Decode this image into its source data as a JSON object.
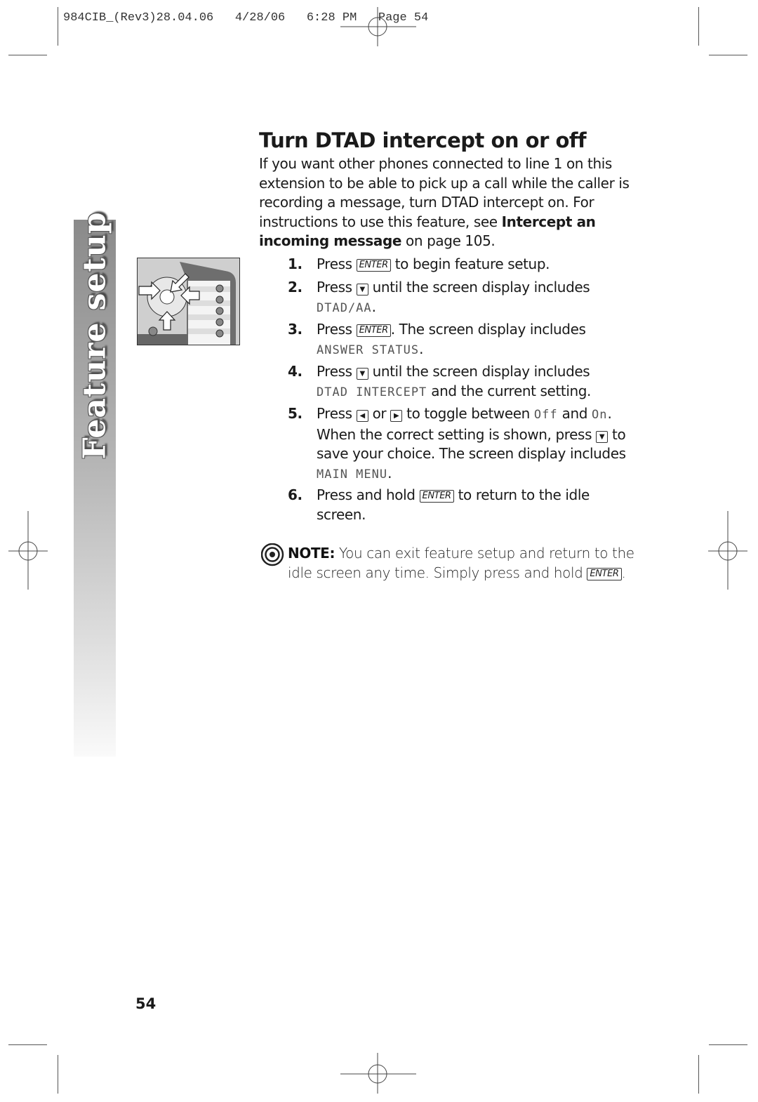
{
  "slug": "984CIB_(Rev3)28.04.06   4/28/06   6:28 PM   Page 54",
  "sidebar": {
    "label": "Feature setup"
  },
  "title": "Turn DTAD intercept on or off",
  "intro": {
    "text": "If you want other phones connected to line 1 on this extension to be able to pick up a call while the caller is recording a message, turn DTAD intercept on.  For instructions to use this feature, see ",
    "bold": "Intercept an incoming message",
    "tail": " on page 105."
  },
  "keys": {
    "enter": "ENTER",
    "down": "▼",
    "left": "◀",
    "right": "▶"
  },
  "steps": [
    {
      "num": "1.",
      "a": "Press ",
      "b": " to begin feature setup."
    },
    {
      "num": "2.",
      "a": "Press ",
      "b": " until the screen display includes",
      "lcd": "DTAD/AA",
      "end": "."
    },
    {
      "num": "3.",
      "a": "Press ",
      "b": ". The screen display includes",
      "lcd": "ANSWER STATUS",
      "end": "."
    },
    {
      "num": "4.",
      "a": "Press ",
      "b": " until the screen display includes",
      "lcd": "DTAD INTERCEPT",
      "end": " and the current setting."
    },
    {
      "num": "5.",
      "a": "Press ",
      "or": " or ",
      "b": " to toggle between ",
      "off": "Off",
      "and": " and ",
      "on": "On",
      "c": ". When the correct setting is shown, press ",
      "d": " to save your choice.  The screen display includes",
      "lcd": "MAIN MENU",
      "end": "."
    },
    {
      "num": "6.",
      "a": "Press and hold  ",
      "b": " to return to the idle screen."
    }
  ],
  "note": {
    "label": "NOTE:",
    "text": " You can exit feature setup and return to the idle screen any time.  Simply press and hold ",
    "end": "."
  },
  "page_number": "54"
}
